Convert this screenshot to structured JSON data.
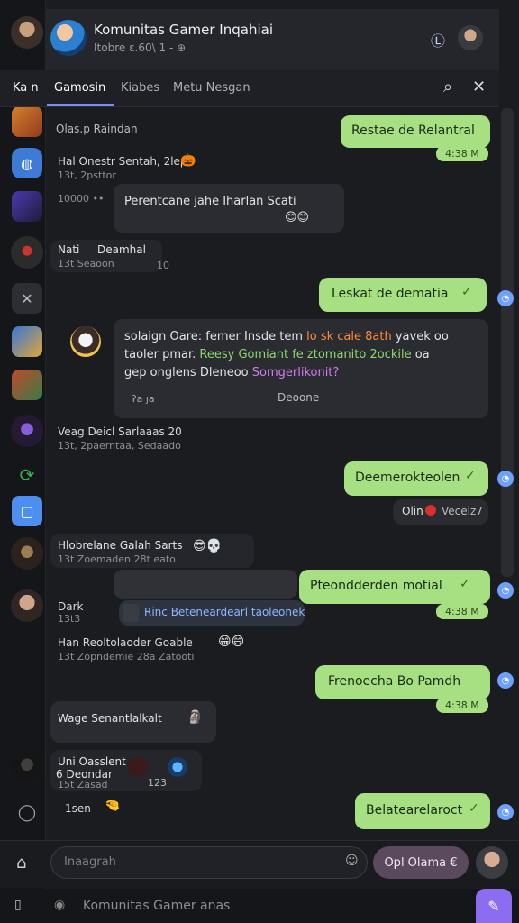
{
  "header": {
    "title": "Komunitas Gamer Inqahiai",
    "subtitle": "Itobre ε.60\\ 1 -",
    "icon_names": [
      "headset-icon",
      "user-avatar"
    ]
  },
  "tabs": [
    {
      "label": "Ka n"
    },
    {
      "label": "Gamosin"
    },
    {
      "label": "Kiabes"
    },
    {
      "label": "Metu Nesgan"
    }
  ],
  "messages": {
    "m1": {
      "name": "Olas.p Raindan"
    },
    "m2": {
      "name": "Hal Onestr Sentah, 2lep",
      "time": "13t, 2psttor"
    },
    "m3": {
      "meta": "10000 ••",
      "text": "Perentcane jahe Iharlan Scati"
    },
    "m4": {
      "name": "Nati",
      "name2": "Deamhal",
      "time": "13t Seaoon",
      "badge": "10"
    },
    "m5": {
      "text": "Leskat de dematia"
    },
    "m6": {
      "line1": "solaign Oare: femer Insde tem",
      "line1_orange": "lo sk cale 8ath",
      "line1_end": "yavek oo",
      "line2a": "taoler pmar.",
      "line2b": "Reesy Gomiant fe ztomanito 2ockile",
      "line2c": "oa",
      "line3a": "gep onglens Dleneoo",
      "line3b": "Somgerlikonit?",
      "footer_left": "ʔa ȷa",
      "footer_right": "Deoone"
    },
    "m7": {
      "name": "Veag Deicl Sarlaaas 20",
      "time": "13t, 2paerntaa, Sedaado"
    },
    "m8": {
      "text": "Deemerokteolen"
    },
    "m8b": {
      "text": "Olin",
      "link": "Vecelz7"
    },
    "m9": {
      "name": "Hlobrelane Galah Sarts",
      "time": "13t Zoemaden 28t eato"
    },
    "m10": {
      "text": "Pteondderden motial",
      "time": "4:38 M"
    },
    "m11": {
      "name": "Dark",
      "time": "13t3",
      "link": "Rinc Beteneardearl taoleonek"
    },
    "m12": {
      "name": "Han Reoltolaoder Goable",
      "time": "13t Zopndemie 28a Zatooti"
    },
    "m13": {
      "text": "Frenoecha Bo Pamdh",
      "time": "4:38 M"
    },
    "m14": {
      "text": "Wage Senantlalkalt"
    },
    "m15": {
      "name": "Uni Oasslent",
      "name2": "6 Deondar",
      "time": "15t Zasad",
      "badge": "123"
    },
    "m16": {
      "text": "1sen"
    },
    "m17": {
      "text": "Belatearelaroct"
    },
    "out1": {
      "text": "Restae de Relantral",
      "time": "4:38 M"
    }
  },
  "composer": {
    "placeholder": "Inaagrah",
    "send_label": "Opl Olama €"
  },
  "footer": {
    "text": "Komunitas Gamer anas"
  },
  "colors": {
    "background": "#1b1c20",
    "bubble_out": "#a6e082",
    "bubble_in": "#2a2c31",
    "accent": "#8c6cf0"
  }
}
